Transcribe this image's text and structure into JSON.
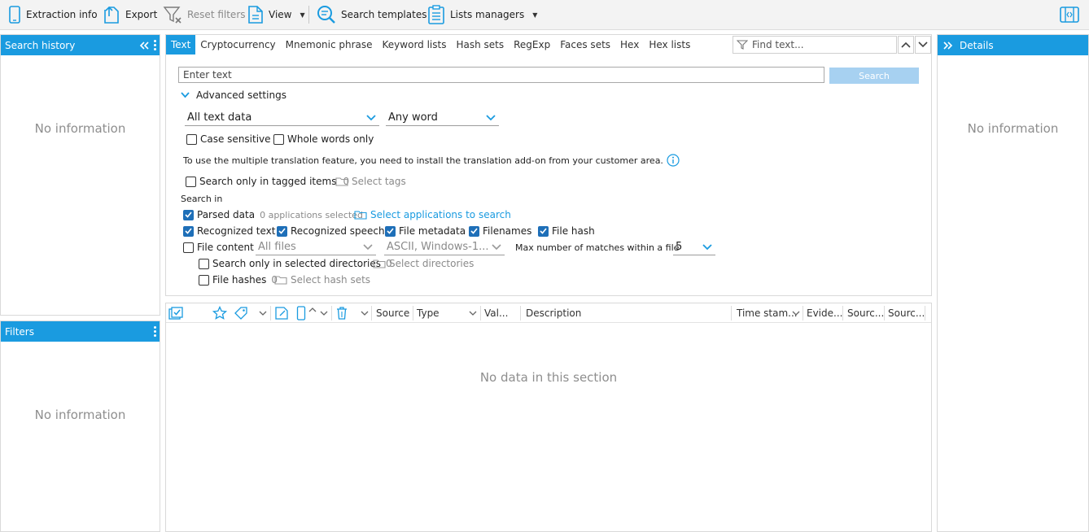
{
  "toolbar": {
    "extraction_info": "Extraction info",
    "export": "Export",
    "reset_filters": "Reset filters",
    "view": "View",
    "search_templates": "Search templates",
    "lists_managers": "Lists managers"
  },
  "left": {
    "search_history": {
      "title": "Search history",
      "empty": "No information"
    },
    "filters": {
      "title": "Filters",
      "empty": "No information"
    }
  },
  "right": {
    "title": "Details",
    "empty": "No information"
  },
  "tabs": [
    "Text",
    "Cryptocurrency",
    "Mnemonic phrase",
    "Keyword lists",
    "Hash sets",
    "RegExp",
    "Faces sets",
    "Hex",
    "Hex lists"
  ],
  "find": {
    "placeholder": "Find text..."
  },
  "search": {
    "placeholder": "Enter text",
    "button": "Search",
    "advanced_settings": "Advanced settings",
    "scope_dropdown": "All text data",
    "word_dropdown": "Any word",
    "case_sensitive": "Case sensitive",
    "whole_words": "Whole words only",
    "translation_notice": "To use the multiple translation feature, you need to install the translation add-on from your customer area.",
    "tagged_only": "Search only in tagged items",
    "tagged_count": "0",
    "select_tags": "Select tags",
    "search_in": "Search in",
    "parsed_data": "Parsed data",
    "apps_selected": "0 applications selected",
    "select_apps": "Select applications to search",
    "recognized_text": "Recognized text",
    "recognized_speech": "Recognized speech",
    "file_metadata": "File metadata",
    "filenames": "Filenames",
    "file_hash": "File hash",
    "file_content": "File content",
    "file_type_dropdown": "All files",
    "encoding_dropdown": "ASCII, Windows-1...",
    "max_matches_label": "Max number of matches within a file",
    "max_matches_value": "5",
    "selected_dirs_only": "Search only in selected directories",
    "dirs_count": "0",
    "select_dirs": "Select directories",
    "file_hashes": "File hashes",
    "hashes_count": "0",
    "select_hash_sets": "Select hash sets"
  },
  "grid": {
    "columns": [
      "Source",
      "Type",
      "Val...",
      "Description",
      "Time stam...",
      "Evide...",
      "Sourc...",
      "Sourc..."
    ],
    "empty": "No data in this section"
  },
  "colors": {
    "accent": "#1a9be0",
    "checkbox": "#1e6fb8"
  }
}
